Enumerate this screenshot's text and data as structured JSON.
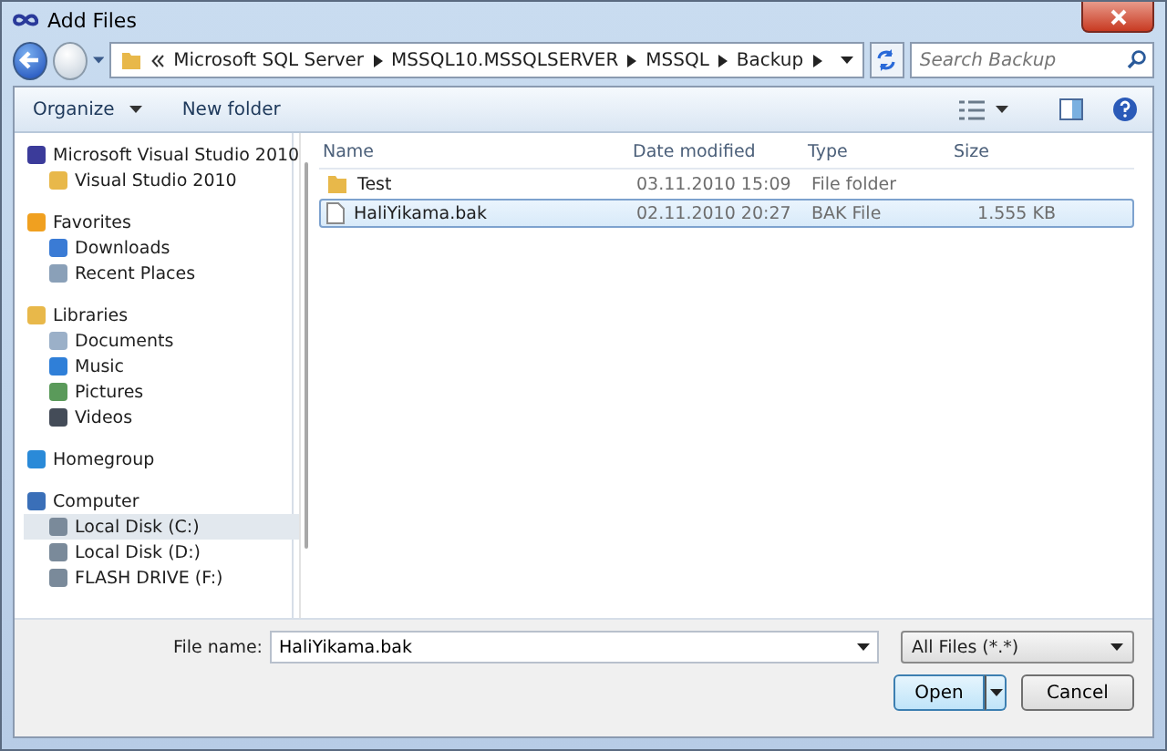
{
  "window": {
    "title": "Add Files"
  },
  "address": {
    "crumbs": [
      "Microsoft SQL Server",
      "MSSQL10.MSSQLSERVER",
      "MSSQL",
      "Backup"
    ],
    "search_placeholder": "Search Backup"
  },
  "toolbar": {
    "organize": "Organize",
    "new_folder": "New folder"
  },
  "nav": [
    {
      "label": "Microsoft Visual Studio 2010",
      "selected": false,
      "children": [
        {
          "label": "Visual Studio 2010",
          "selected": false
        }
      ]
    },
    {
      "label": "Favorites",
      "selected": false,
      "children": [
        {
          "label": "Downloads",
          "selected": false
        },
        {
          "label": "Recent Places",
          "selected": false
        }
      ]
    },
    {
      "label": "Libraries",
      "selected": false,
      "children": [
        {
          "label": "Documents",
          "selected": false
        },
        {
          "label": "Music",
          "selected": false
        },
        {
          "label": "Pictures",
          "selected": false
        },
        {
          "label": "Videos",
          "selected": false
        }
      ]
    },
    {
      "label": "Homegroup",
      "selected": false
    },
    {
      "label": "Computer",
      "selected": false,
      "children": [
        {
          "label": "Local Disk (C:)",
          "selected": true
        },
        {
          "label": "Local Disk (D:)",
          "selected": false
        },
        {
          "label": "FLASH DRIVE (F:)",
          "selected": false
        }
      ]
    }
  ],
  "columns": [
    "Name",
    "Date modified",
    "Type",
    "Size"
  ],
  "files": [
    {
      "name": "Test",
      "date": "03.11.2010 15:09",
      "type": "File folder",
      "kind": "folder",
      "selected": false
    },
    {
      "name": "HaliYikama.bak",
      "date": "02.11.2010 20:27",
      "type": "BAK File",
      "size": "1.555 KB",
      "kind": "file",
      "selected": true
    }
  ],
  "footer": {
    "file_name_label": "File name:",
    "file_name": "HaliYikama.bak",
    "filter": "All Files (*.*)",
    "open": "Open",
    "cancel": "Cancel"
  }
}
